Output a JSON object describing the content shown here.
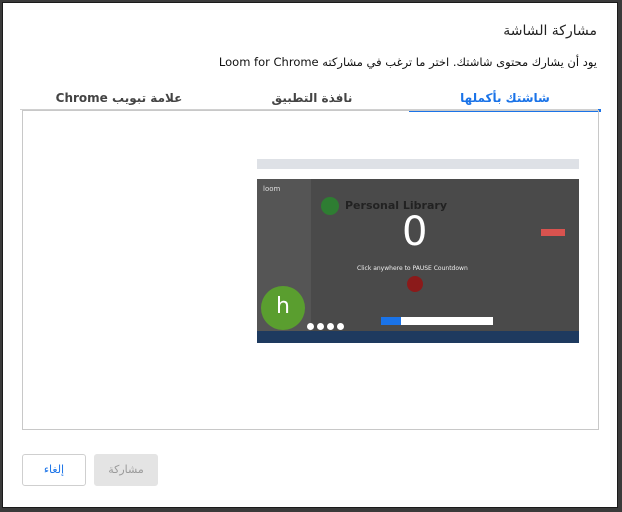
{
  "dialog": {
    "title": "مشاركة الشاشة",
    "subtitle": "يود أن يشارك محتوى شاشتك. اختر ما ترغب في مشاركته Loom for Chrome"
  },
  "tabs": [
    {
      "label": "شاشتك بأكملها",
      "active": true
    },
    {
      "label": "نافذة التطبيق",
      "active": false
    },
    {
      "label": "علامة تبويب Chrome",
      "active": false
    }
  ],
  "preview": {
    "app_logo": "loom",
    "library_title": "Personal Library",
    "countdown": "0",
    "click_hint": "Click anywhere to PAUSE Countdown",
    "avatar_letter": "h"
  },
  "buttons": {
    "cancel": "إلغاء",
    "share": "مشاركة"
  },
  "colors": {
    "accent": "#1a73e8",
    "avatar": "#5a9e2f"
  }
}
